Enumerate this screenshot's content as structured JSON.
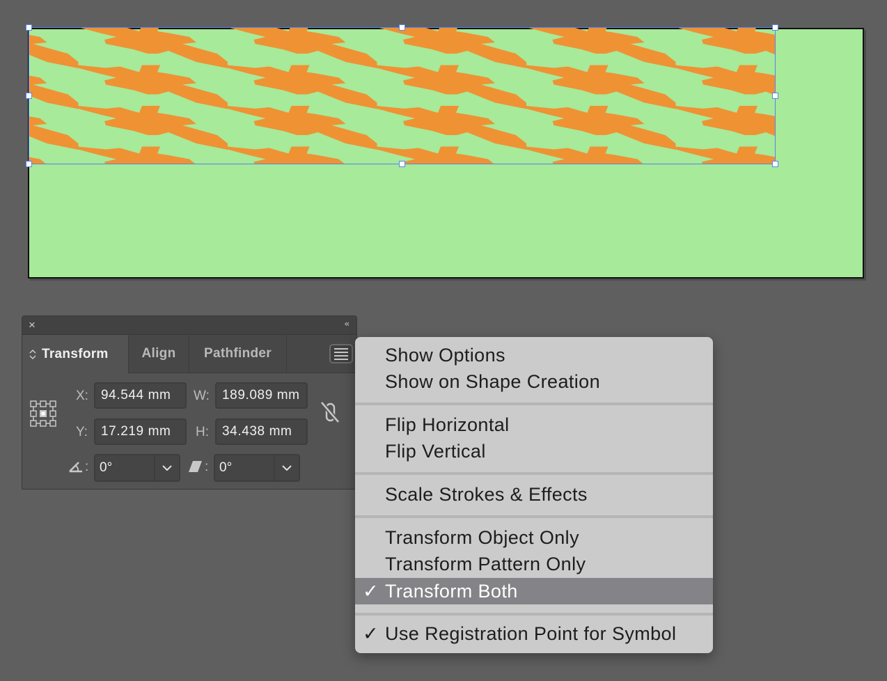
{
  "canvas": {
    "artboard_color": "#a6ea9a",
    "pattern_color": "#ef9234",
    "selection_color": "#5b82f0",
    "pattern_description": "carrot-silhouette-pattern"
  },
  "panel": {
    "close_icon": "×",
    "collapse_icon": "‹‹",
    "tabs": [
      {
        "label": "Transform",
        "active": true
      },
      {
        "label": "Align",
        "active": false
      },
      {
        "label": "Pathfinder",
        "active": false
      }
    ],
    "fields": {
      "x_label": "X:",
      "x_value": "94.544 mm",
      "y_label": "Y:",
      "y_value": "17.219 mm",
      "w_label": "W:",
      "w_value": "189.089 mm",
      "h_label": "H:",
      "h_value": "34.438 mm",
      "rotate_label": ":",
      "rotate_value": "0°",
      "shear_label": ":",
      "shear_value": "0°"
    },
    "proportions_link": "unlinked"
  },
  "menu": {
    "groups": [
      [
        {
          "label": "Show Options",
          "checked": false,
          "highlighted": false
        },
        {
          "label": "Show on Shape Creation",
          "checked": false,
          "highlighted": false
        }
      ],
      [
        {
          "label": "Flip Horizontal",
          "checked": false,
          "highlighted": false
        },
        {
          "label": "Flip Vertical",
          "checked": false,
          "highlighted": false
        }
      ],
      [
        {
          "label": "Scale Strokes & Effects",
          "checked": false,
          "highlighted": false
        }
      ],
      [
        {
          "label": "Transform Object Only",
          "checked": false,
          "highlighted": false
        },
        {
          "label": "Transform Pattern Only",
          "checked": false,
          "highlighted": false
        },
        {
          "label": "Transform Both",
          "checked": true,
          "highlighted": true
        }
      ],
      [
        {
          "label": "Use Registration Point for Symbol",
          "checked": true,
          "highlighted": false
        }
      ]
    ],
    "items_flat": [
      "Show Options",
      "Show on Shape Creation",
      "Flip Horizontal",
      "Flip Vertical",
      "Scale Strokes & Effects",
      "Transform Object Only",
      "Transform Pattern Only",
      "Transform Both",
      "Use Registration Point for Symbol"
    ],
    "check_glyph": "✓"
  }
}
